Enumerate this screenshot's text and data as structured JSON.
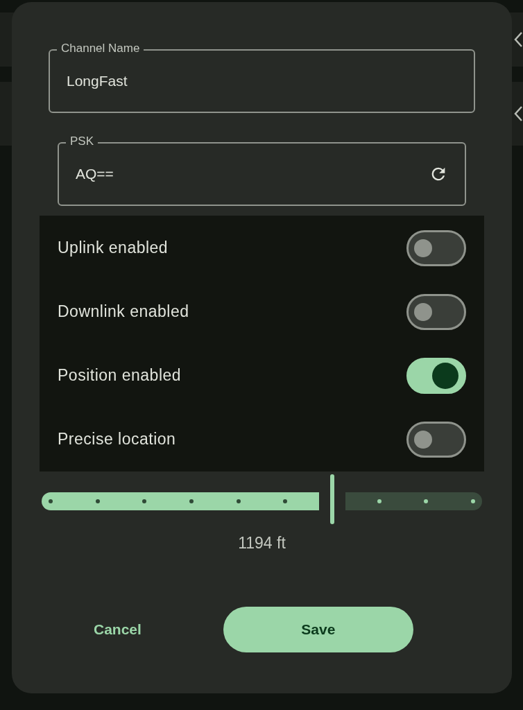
{
  "channel_name": {
    "label": "Channel Name",
    "value": "LongFast"
  },
  "psk": {
    "label": "PSK",
    "value": "AQ=="
  },
  "toggles": [
    {
      "label": "Uplink enabled",
      "on": false
    },
    {
      "label": "Downlink enabled",
      "on": false
    },
    {
      "label": "Position enabled",
      "on": true
    },
    {
      "label": "Precise location",
      "on": false
    }
  ],
  "precision": {
    "level": 0.667,
    "reading": "1194 ft"
  },
  "buttons": {
    "cancel": "Cancel",
    "save": "Save"
  }
}
